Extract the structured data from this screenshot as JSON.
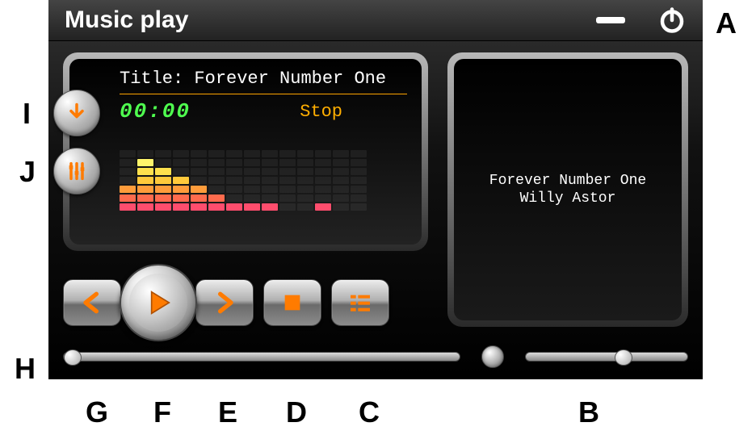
{
  "header": {
    "title": "Music play"
  },
  "display": {
    "title_prefix": "Title: ",
    "track_title": "Forever Number One",
    "time": "00:00",
    "status": "Stop",
    "eq_levels": [
      3,
      6,
      5,
      4,
      3,
      2,
      1,
      1,
      1,
      0,
      0,
      1,
      0,
      0
    ]
  },
  "playlist": {
    "track": "Forever Number One",
    "artist": "Willy Astor"
  },
  "sliders": {
    "progress_percent": 0,
    "volume_percent": 55
  },
  "labels": {
    "A": "A",
    "B": "B",
    "C": "C",
    "D": "D",
    "E": "E",
    "F": "F",
    "G": "G",
    "H": "H",
    "I": "I",
    "J": "J"
  }
}
